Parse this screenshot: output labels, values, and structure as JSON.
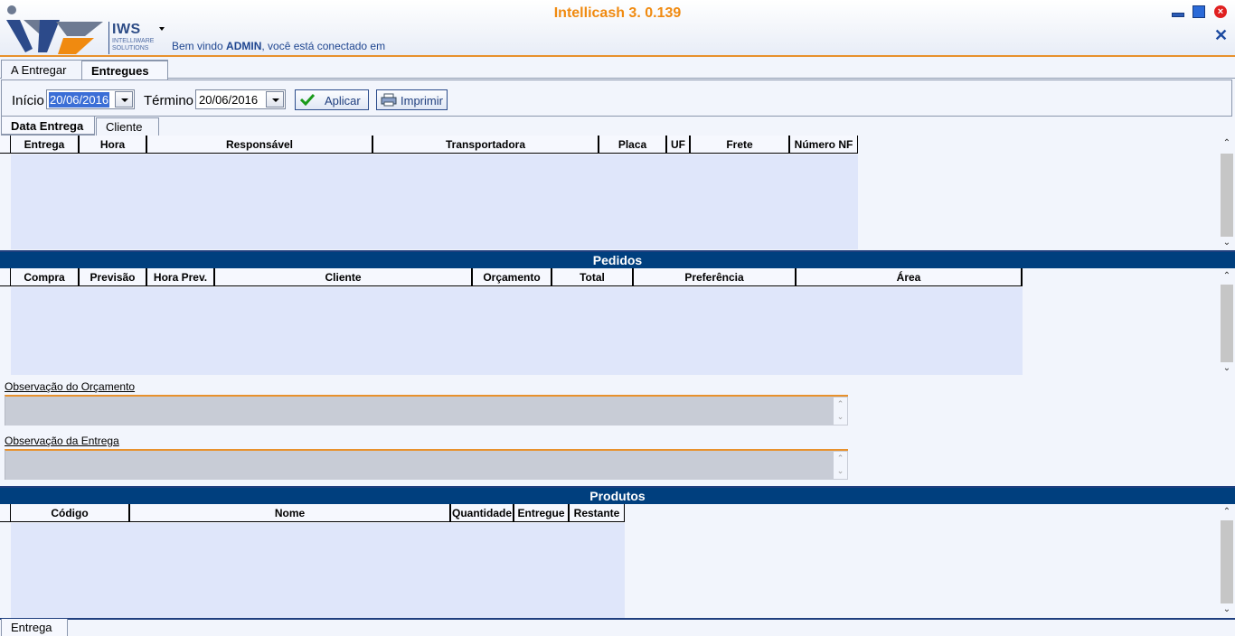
{
  "header": {
    "app_title": "Intellicash 3. 0.139",
    "logo_text": "IWS",
    "logo_sub": "INTELLIWARE SOLUTIONS",
    "welcome_prefix": "Bem vindo ",
    "welcome_user": "ADMIN",
    "welcome_suffix": ", você está conectado em"
  },
  "main_tabs": [
    "A Entregar",
    "Entregues"
  ],
  "filter": {
    "start_label": "Início",
    "start_value": "20/06/2016",
    "end_label": "Término",
    "end_value": "20/06/2016",
    "apply_label": "Aplicar",
    "print_label": "Imprimir"
  },
  "sub_tabs": [
    "Data Entrega",
    "Cliente"
  ],
  "deliveries_columns": [
    "Entrega",
    "Hora",
    "Responsável",
    "Transportadora",
    "Placa",
    "UF",
    "Frete",
    "Número NF"
  ],
  "orders": {
    "title": "Pedidos",
    "columns": [
      "Compra",
      "Previsão",
      "Hora Prev.",
      "Cliente",
      "Orçamento",
      "Total",
      "Preferência",
      "Área"
    ]
  },
  "obs_orcamento_label": "Observação do Orçamento",
  "obs_entrega_label": "Observação da Entrega",
  "products": {
    "title": "Produtos",
    "columns": [
      "Código",
      "Nome",
      "Quantidade",
      "Entregue",
      "Restante"
    ]
  },
  "bottom_tab": "Entrega",
  "colors": {
    "accent": "#e8912c",
    "section_bar": "#003f7e",
    "grid_body": "#dfe6fa"
  }
}
